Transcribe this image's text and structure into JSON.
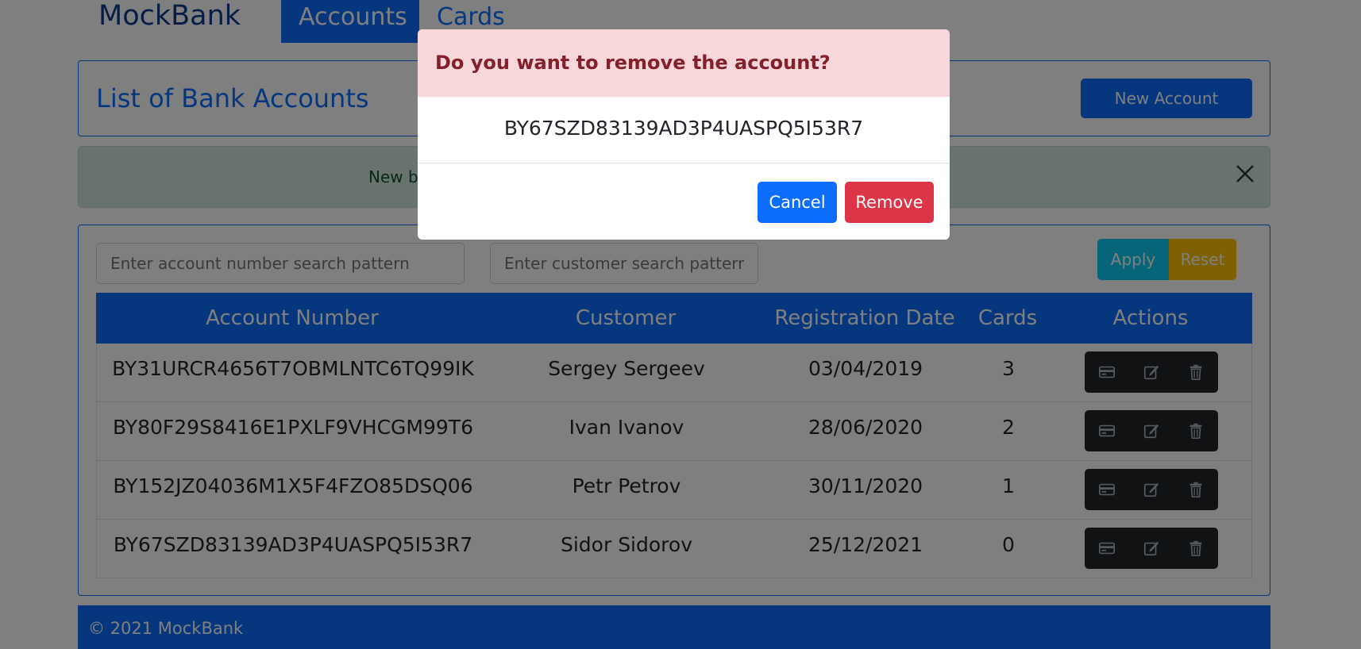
{
  "navbar": {
    "brand": "MockBank",
    "tabs": [
      {
        "label": "Accounts",
        "active": true
      },
      {
        "label": "Cards",
        "active": false
      }
    ]
  },
  "header": {
    "title": "List of Bank Accounts",
    "new_account_label": "New Account"
  },
  "alert": {
    "visible_text": "New b"
  },
  "filters": {
    "account_placeholder": "Enter account number search pattern",
    "customer_placeholder": "Enter customer search pattern",
    "apply_label": "Apply",
    "reset_label": "Reset"
  },
  "table": {
    "columns": [
      "Account Number",
      "Customer",
      "Registration Date",
      "Cards",
      "Actions"
    ],
    "rows": [
      {
        "account": "BY31URCR4656T7OBMLNTC6TQ99IK",
        "customer": "Sergey Sergeev",
        "date": "03/04/2019",
        "cards": "3"
      },
      {
        "account": "BY80F29S8416E1PXLF9VHCGM99T6",
        "customer": "Ivan Ivanov",
        "date": "28/06/2020",
        "cards": "2"
      },
      {
        "account": "BY152JZ04036M1X5F4FZO85DSQ06",
        "customer": "Petr Petrov",
        "date": "30/11/2020",
        "cards": "1"
      },
      {
        "account": "BY67SZD83139AD3P4UASPQ5I53R7",
        "customer": "Sidor Sidorov",
        "date": "25/12/2021",
        "cards": "0"
      }
    ],
    "row_action_icons": [
      "credit-card-icon",
      "edit-icon",
      "trash-icon"
    ]
  },
  "footer": {
    "text": "© 2021 MockBank"
  },
  "modal": {
    "title": "Do you want to remove the account?",
    "account_number": "BY67SZD83139AD3P4UASPQ5I53R7",
    "cancel_label": "Cancel",
    "remove_label": "Remove"
  },
  "colors": {
    "primary": "#0d6efd",
    "danger": "#dc3545",
    "info": "#0dcaf0",
    "warning": "#ffc107",
    "success_bg": "#d1e7dd",
    "danger_bg": "#f8d7da",
    "dark": "#212529"
  }
}
